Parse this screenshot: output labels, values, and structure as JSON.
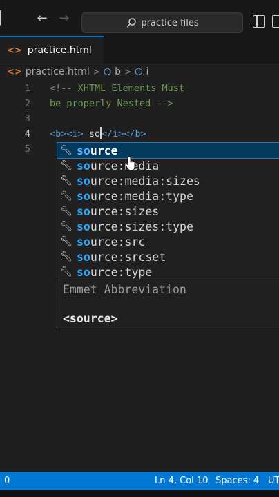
{
  "search": {
    "label": "practice files"
  },
  "tab": {
    "filename": "practice.html"
  },
  "breadcrumb": {
    "file": "practice.html",
    "sym1": "b",
    "sym2": "i"
  },
  "editor": {
    "lines": [
      {
        "num": "1",
        "text": "<!-- XHTML Elements Must"
      },
      {
        "num": "2",
        "text": "be properly Nested -->"
      },
      {
        "num": "3",
        "text": ""
      },
      {
        "num": "4",
        "open_b": "<b>",
        "open_i": "<i>",
        "typed": "so",
        "close_i": "</i>",
        "close_b": "</b>"
      },
      {
        "num": "5",
        "text": ""
      }
    ]
  },
  "suggestions": {
    "match": "so",
    "items": [
      {
        "rest": "urce"
      },
      {
        "rest": "urce:media"
      },
      {
        "rest": "urce:media:sizes"
      },
      {
        "rest": "urce:media:type"
      },
      {
        "rest": "urce:sizes"
      },
      {
        "rest": "urce:sizes:type"
      },
      {
        "rest": "urce:src"
      },
      {
        "rest": "urce:srcset"
      },
      {
        "rest": "urce:type"
      }
    ],
    "detail_title": "Emmet Abbreviation",
    "detail_code": "<source>"
  },
  "status": {
    "left": "0",
    "position": "Ln 4, Col 10",
    "spaces": "Spaces: 4",
    "encoding": "UT"
  },
  "colors": {
    "accent": "#0078d4",
    "selection": "#04395e",
    "match": "#2aaaff",
    "comment": "#6a9955"
  }
}
